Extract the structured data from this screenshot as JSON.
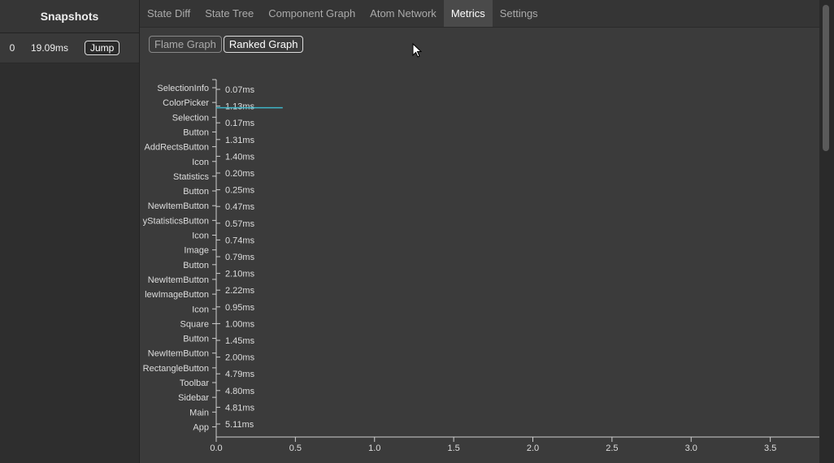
{
  "snapshots": {
    "title": "Snapshots",
    "items": [
      {
        "index": "0",
        "time": "19.09ms",
        "jump_label": "Jump"
      }
    ]
  },
  "tabs": [
    "State Diff",
    "State Tree",
    "Component Graph",
    "Atom Network",
    "Metrics",
    "Settings"
  ],
  "active_tab": "Metrics",
  "subtabs": [
    "Flame Graph",
    "Ranked Graph"
  ],
  "active_subtab": "Ranked Graph",
  "chart_data": {
    "type": "bar",
    "orientation": "horizontal",
    "categories": [
      "SelectionInfo",
      "ColorPicker",
      "Selection",
      "Button",
      "AddRectsButton",
      "Icon",
      "Statistics",
      "Button",
      "NewItemButton",
      "yStatisticsButton",
      "Icon",
      "Image",
      "Button",
      "NewItemButton",
      "lewImageButton",
      "Icon",
      "Square",
      "Button",
      "NewItemButton",
      "RectangleButton",
      "Toolbar",
      "Sidebar",
      "Main",
      "App"
    ],
    "value_labels": [
      "0.07ms",
      "1.13ms",
      "0.17ms",
      "1.31ms",
      "1.40ms",
      "0.20ms",
      "0.25ms",
      "0.47ms",
      "0.57ms",
      "0.74ms",
      "0.79ms",
      "2.10ms",
      "2.22ms",
      "0.95ms",
      "1.00ms",
      "1.45ms",
      "2.00ms",
      "4.79ms",
      "4.80ms",
      "4.81ms",
      "5.11ms"
    ],
    "highlight": {
      "row": 1,
      "value": 0.42
    },
    "xticks": [
      0.0,
      0.5,
      1.0,
      1.5,
      2.0,
      2.5,
      3.0,
      3.5
    ],
    "xtick_labels": [
      "0.0",
      "0.5",
      "1.0",
      "1.5",
      "2.0",
      "2.5",
      "3.0",
      "3.5"
    ],
    "highlight_color": "#3fb6c8"
  }
}
